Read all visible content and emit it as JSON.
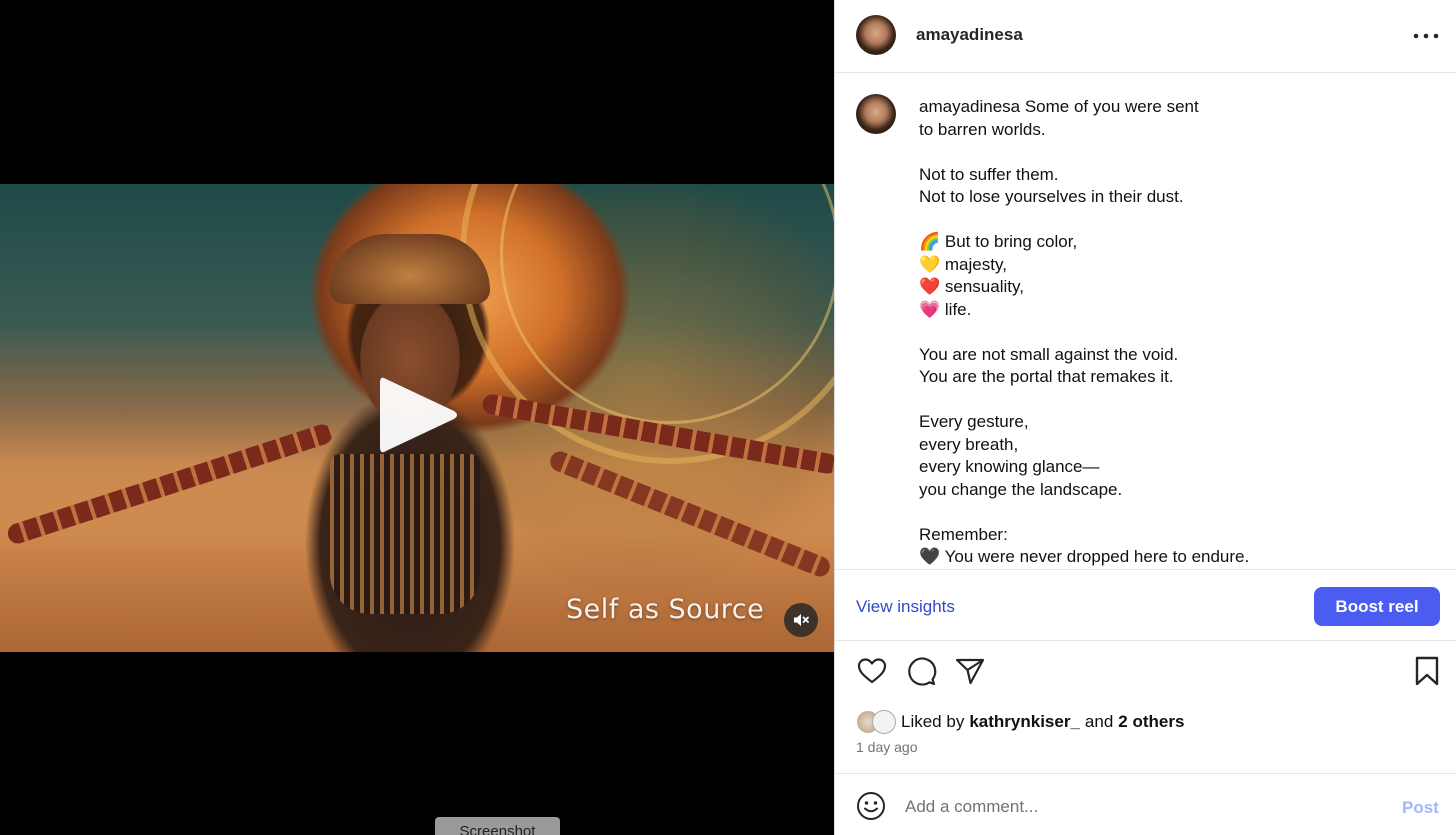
{
  "media": {
    "overlay_text": "Self as Source",
    "play_icon": "play-icon",
    "mute_icon": "speaker-muted-icon"
  },
  "tooltip": {
    "label": "Screenshot"
  },
  "post": {
    "username": "amayadinesa",
    "more_icon": "more-horizontal-icon",
    "caption_username": "amayadinesa",
    "caption_text": " Some of you were sent\nto barren worlds.\n\nNot to suffer them.\nNot to lose yourselves in their dust.\n\n🌈 But to bring color,\n💛 majesty,\n❤️ sensuality,\n💗 life.\n\nYou are not small against the void.\nYou are the portal that remakes it.\n\nEvery gesture,\nevery breath,\nevery knowing glance—\nyou change the landscape.\n\nRemember:\n🖤 You were never dropped here to endure."
  },
  "insights": {
    "view_label": "View insights",
    "boost_label": "Boost reel"
  },
  "actions": {
    "like_icon": "heart-icon",
    "comment_icon": "comment-icon",
    "share_icon": "paper-plane-icon",
    "save_icon": "bookmark-icon"
  },
  "likes": {
    "prefix": "Liked by",
    "user": "kathrynkiser_",
    "conjunction": "and",
    "others": "2 others"
  },
  "time": "1 day ago",
  "comment": {
    "placeholder": "Add a comment...",
    "post_label": "Post"
  },
  "colors": {
    "accent": "#4a5df0",
    "link": "#2f49c9",
    "post_disabled": "#a8b6f5"
  }
}
